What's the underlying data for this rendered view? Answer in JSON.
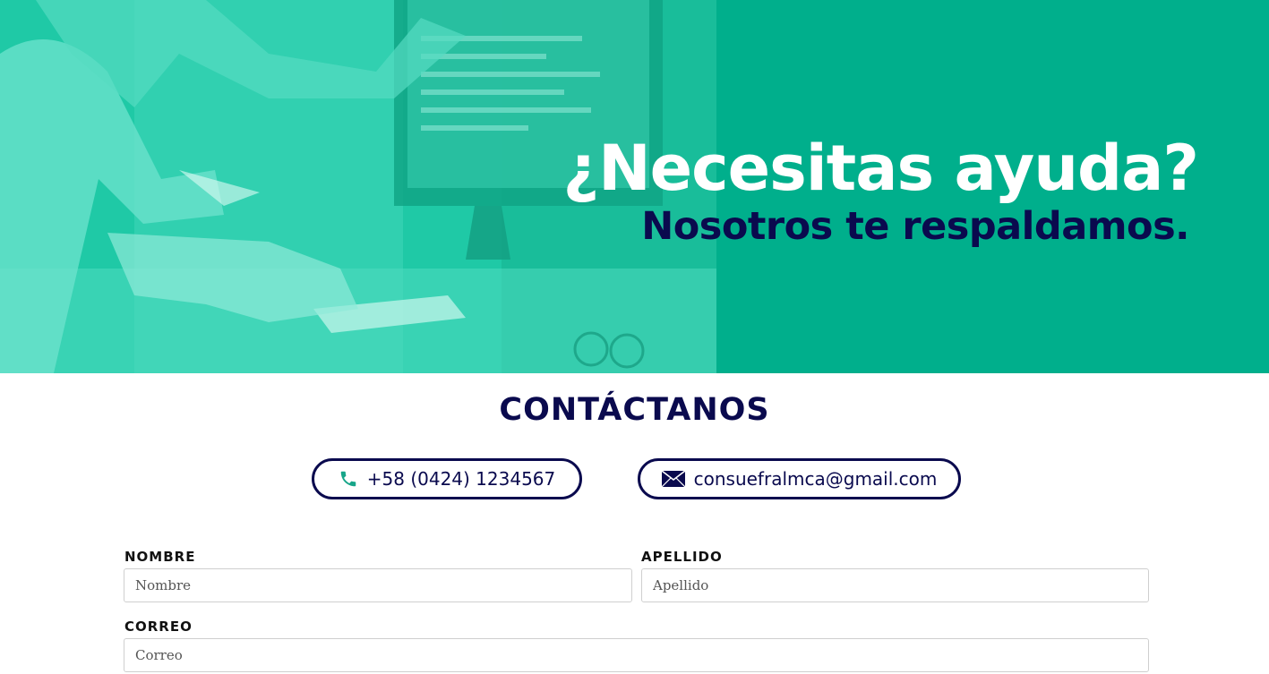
{
  "hero": {
    "title": "¿Necesitas ayuda?",
    "subtitle": "Nosotros te respaldamos.",
    "background_color": "#00af8c"
  },
  "contact": {
    "title": "CONTÁCTANOS",
    "phone": {
      "icon": "phone-icon",
      "text": "+58 (0424) 1234567"
    },
    "email": {
      "icon": "envelope-icon",
      "text": "consuefralmca@gmail.com"
    },
    "accent_color": "#0a0a4e",
    "icon_green": "#17a589"
  },
  "form": {
    "nombre": {
      "label": "NOMBRE",
      "placeholder": "Nombre"
    },
    "apellido": {
      "label": "APELLIDO",
      "placeholder": "Apellido"
    },
    "correo": {
      "label": "CORREO",
      "placeholder": "Correo"
    }
  }
}
